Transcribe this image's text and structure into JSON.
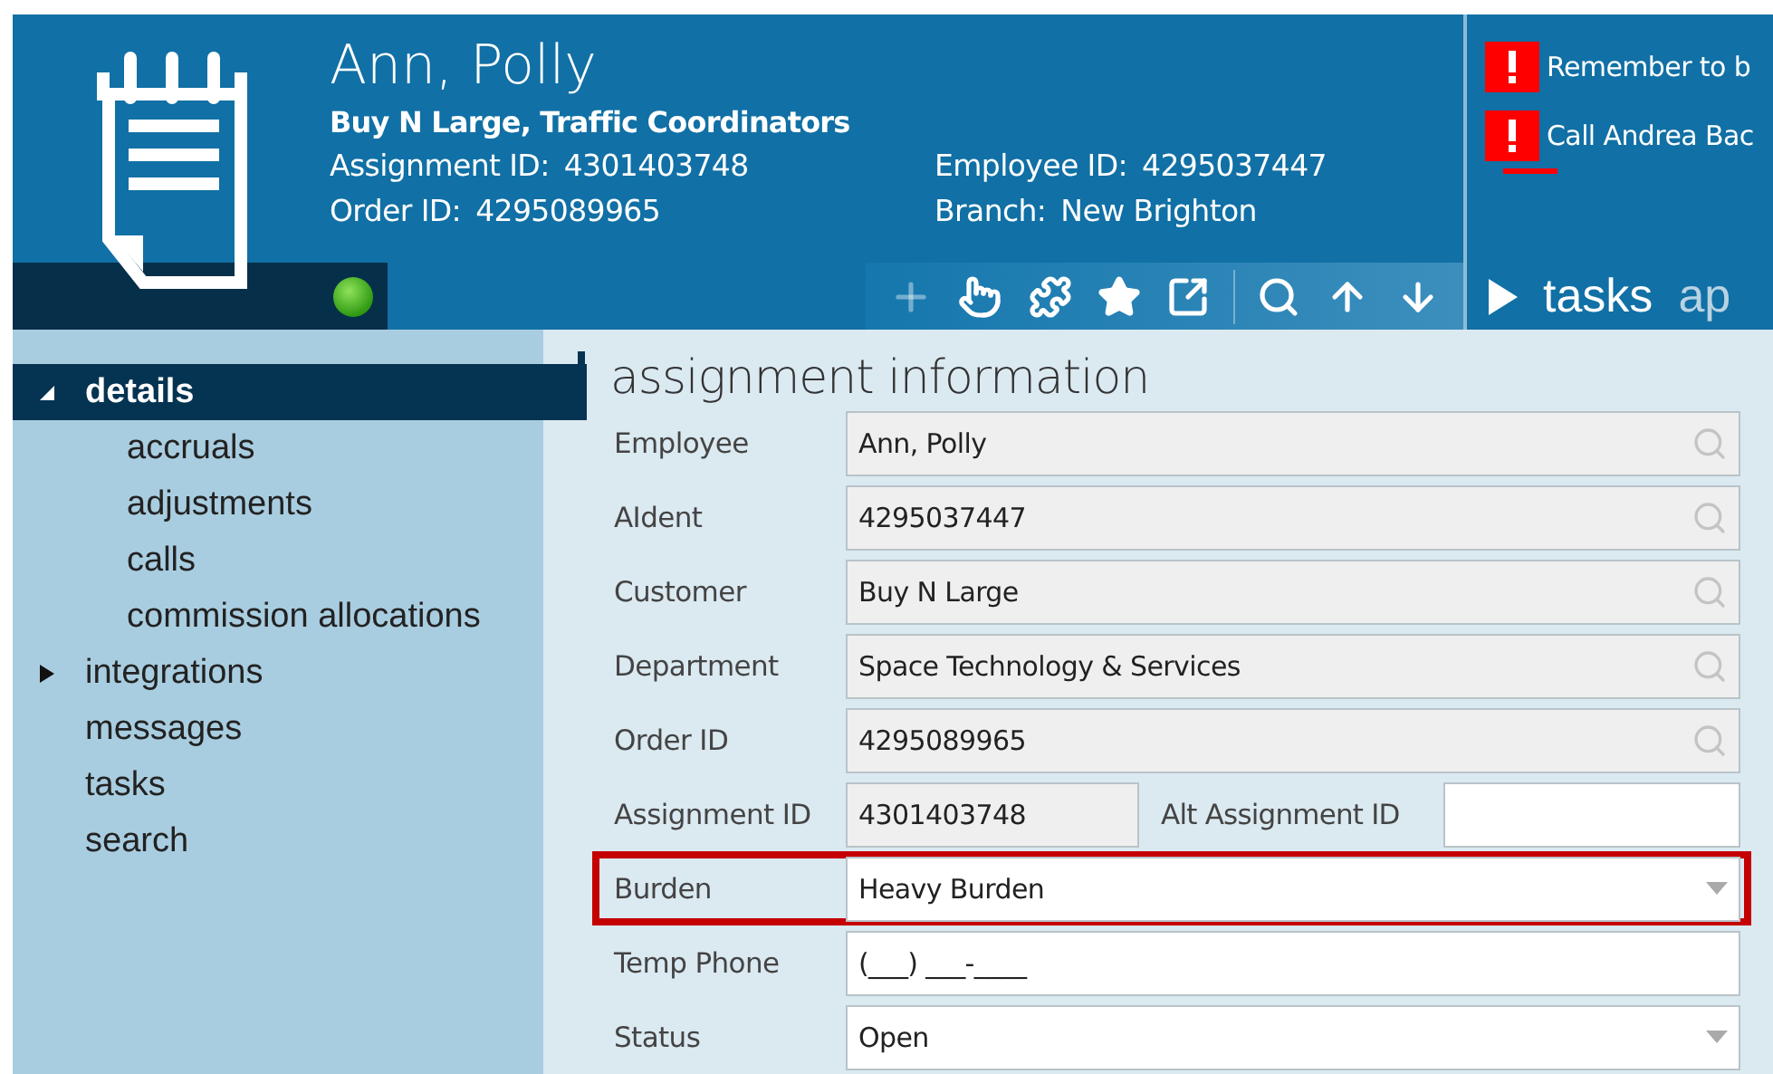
{
  "header": {
    "name": "Ann, Polly",
    "company": "Buy N Large, Traffic Coordinators",
    "online": true,
    "info": [
      {
        "label": "Assignment ID:",
        "value": "4301403748"
      },
      {
        "label": "Employee ID:",
        "value": "4295037447"
      },
      {
        "label": "Order ID:",
        "value": "4295089965"
      },
      {
        "label": "Branch:",
        "value": "New Brighton"
      }
    ],
    "toolbar": [
      {
        "kind": "add",
        "disabled": true
      },
      {
        "kind": "pointer",
        "disabled": false
      },
      {
        "kind": "puzzle",
        "disabled": false
      },
      {
        "kind": "star",
        "disabled": false
      },
      {
        "kind": "export",
        "disabled": false
      },
      {
        "kind": "search",
        "disabled": false
      },
      {
        "kind": "up",
        "disabled": false
      },
      {
        "kind": "down",
        "disabled": false
      }
    ]
  },
  "alerts": [
    "Remember to b",
    "Call Andrea Bac"
  ],
  "panel_tabs": [
    {
      "label": "tasks",
      "selected": true
    },
    {
      "label": "ap",
      "selected": false
    }
  ],
  "sidebar": {
    "items": [
      {
        "label": "details",
        "kind": "group",
        "expanded": true,
        "selected": true,
        "children": [
          {
            "label": "accruals"
          },
          {
            "label": "adjustments"
          },
          {
            "label": "calls"
          },
          {
            "label": "commission allocations"
          }
        ]
      },
      {
        "label": "integrations",
        "kind": "group",
        "expanded": false,
        "selected": false
      },
      {
        "label": "messages",
        "kind": "leaf",
        "selected": false
      },
      {
        "label": "tasks",
        "kind": "leaf",
        "selected": false
      },
      {
        "label": "search",
        "kind": "leaf",
        "selected": false
      }
    ]
  },
  "section": {
    "title": "assignment information",
    "fields": [
      {
        "label": "Employee",
        "kind": "lookup",
        "value": "Ann, Polly",
        "highlighted": false
      },
      {
        "label": "AIdent",
        "kind": "lookup",
        "value": "4295037447",
        "highlighted": false
      },
      {
        "label": "Customer",
        "kind": "lookup",
        "value": "Buy N Large",
        "highlighted": false
      },
      {
        "label": "Department",
        "kind": "lookup",
        "value": "Space Technology & Services",
        "highlighted": false
      },
      {
        "label": "Order ID",
        "kind": "lookup",
        "value": "4295089965",
        "highlighted": false
      },
      {
        "label": "Assignment ID",
        "kind": "split",
        "value": "4301403748",
        "label_2": "Alt Assignment ID",
        "highlighted": false
      },
      {
        "label": "Burden",
        "kind": "dropdown",
        "value": "Heavy Burden",
        "highlighted": true
      },
      {
        "label": "Temp Phone",
        "kind": "text",
        "value": "(___) ___-____",
        "highlighted": false
      },
      {
        "label": "Status",
        "kind": "dropdown",
        "value": "Open",
        "highlighted": false
      }
    ]
  }
}
